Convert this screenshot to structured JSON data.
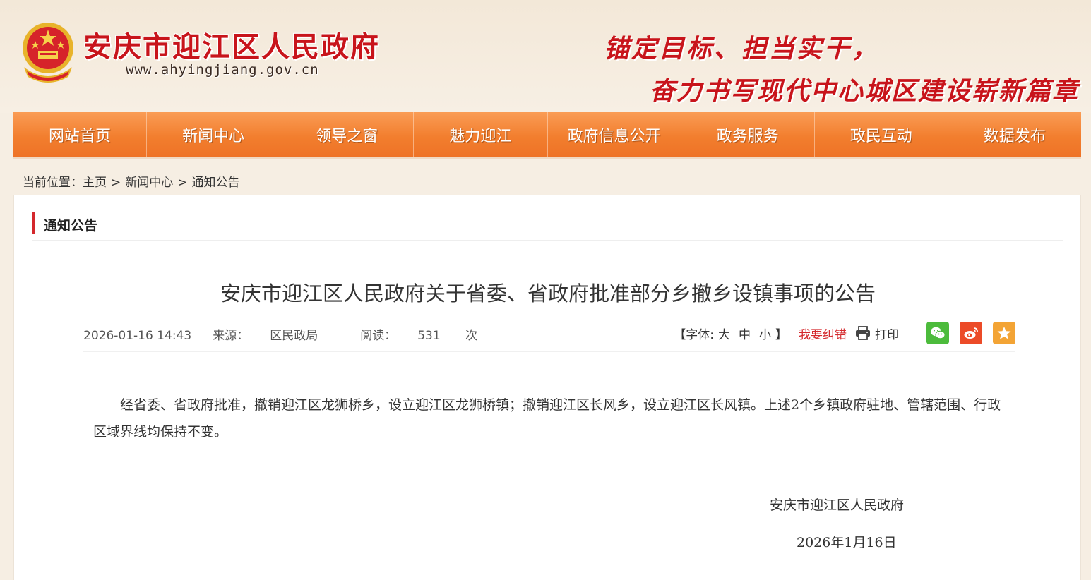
{
  "header": {
    "site_title": "安庆市迎江区人民政府",
    "site_url": "www.ahyingjiang.gov.cn",
    "slogan_line1": "锚定目标、担当实干，",
    "slogan_line2": "奋力书写现代中心城区建设崭新篇章"
  },
  "nav": {
    "items": [
      "网站首页",
      "新闻中心",
      "领导之窗",
      "魅力迎江",
      "政府信息公开",
      "政务服务",
      "政民互动",
      "数据发布"
    ]
  },
  "breadcrumb": {
    "prefix": "当前位置：",
    "items": [
      "主页",
      "新闻中心",
      "通知公告"
    ],
    "separator": ">"
  },
  "section": {
    "title": "通知公告"
  },
  "article": {
    "title": "安庆市迎江区人民政府关于省委、省政府批准部分乡撤乡设镇事项的公告",
    "datetime": "2026-01-16 14:43",
    "source_label": "来源：",
    "source": "区民政局",
    "views_label": "阅读：",
    "views": "531",
    "views_unit": "次",
    "font_label_open": "【字体:",
    "font_large": "大",
    "font_medium": "中",
    "font_small": "小",
    "font_label_close": "】",
    "report_label": "我要纠错",
    "print_label": "打印",
    "body": "经省委、省政府批准，撤销迎江区龙狮桥乡，设立迎江区龙狮桥镇；撤销迎江区长风乡，设立迎江区长风镇。上述2个乡镇政府驻地、管辖范围、行政区域界线均保持不变。",
    "signature": "安庆市迎江区人民政府",
    "signature_date": "2026年1月16日"
  },
  "icons": {
    "emblem": "national-emblem-icon",
    "print": "printer-icon",
    "wechat": "wechat-icon",
    "weibo": "weibo-icon",
    "favorite": "star-icon"
  },
  "colors": {
    "brand_red": "#c8141b",
    "nav_orange": "#f27e2e",
    "page_bg": "#f6eee3",
    "accent_bar": "#d4282c"
  }
}
